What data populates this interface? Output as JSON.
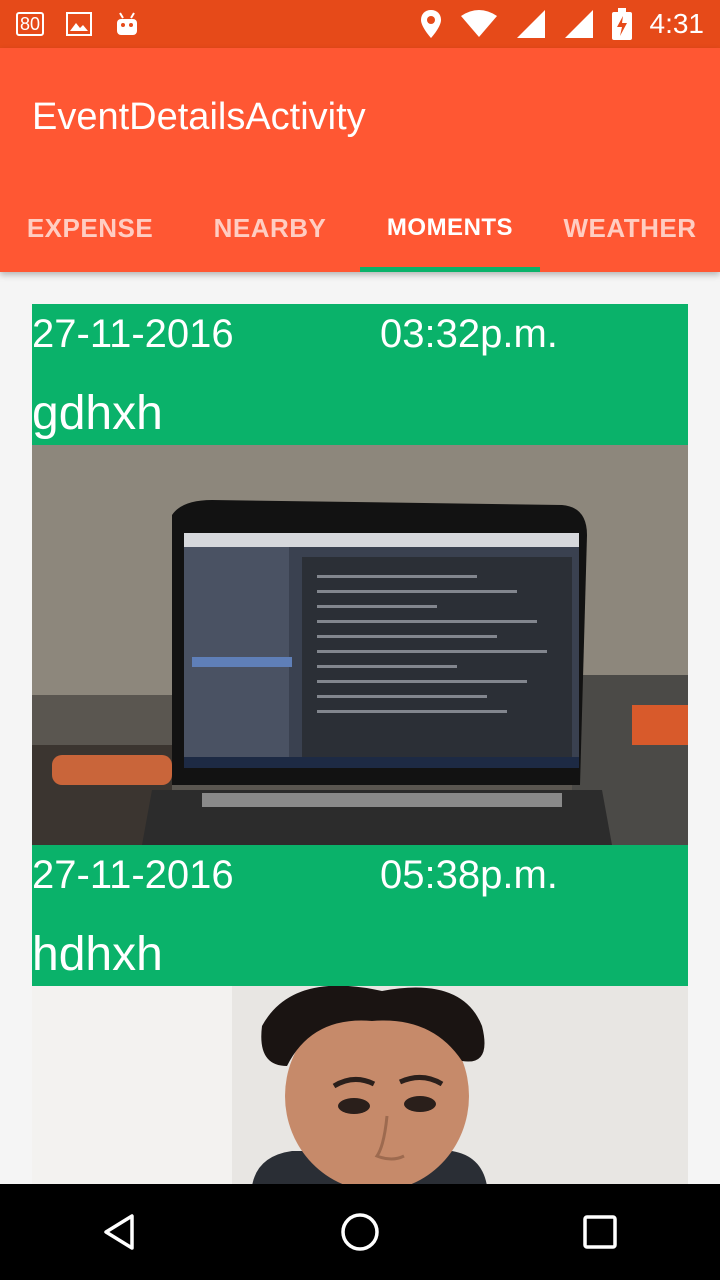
{
  "status_bar": {
    "battery_saver_label": "80",
    "time": "4:31",
    "icons": [
      "battery-80-icon",
      "image-icon",
      "android-icon",
      "location-icon",
      "wifi-icon",
      "signal-icon",
      "signal-icon",
      "battery-charging-icon"
    ]
  },
  "app_bar": {
    "title": "EventDetailsActivity",
    "background": "#FF5733"
  },
  "tabs": [
    {
      "label": "EXPENSE",
      "active": false
    },
    {
      "label": "NEARBY",
      "active": false
    },
    {
      "label": "MOMENTS",
      "active": true
    },
    {
      "label": "WEATHER",
      "active": false
    }
  ],
  "moments": [
    {
      "date": "27-11-2016",
      "time": "03:32p.m.",
      "caption": "gdhxh",
      "photo": "laptop-photo"
    },
    {
      "date": "27-11-2016",
      "time": "05:38p.m.",
      "caption": "hdhxh",
      "photo": "face-photo"
    }
  ],
  "colors": {
    "status_bar": "#E64A19",
    "accent": "#0ab26a"
  },
  "nav_bar": {
    "icons": [
      "back-icon",
      "home-icon",
      "recents-icon"
    ]
  }
}
